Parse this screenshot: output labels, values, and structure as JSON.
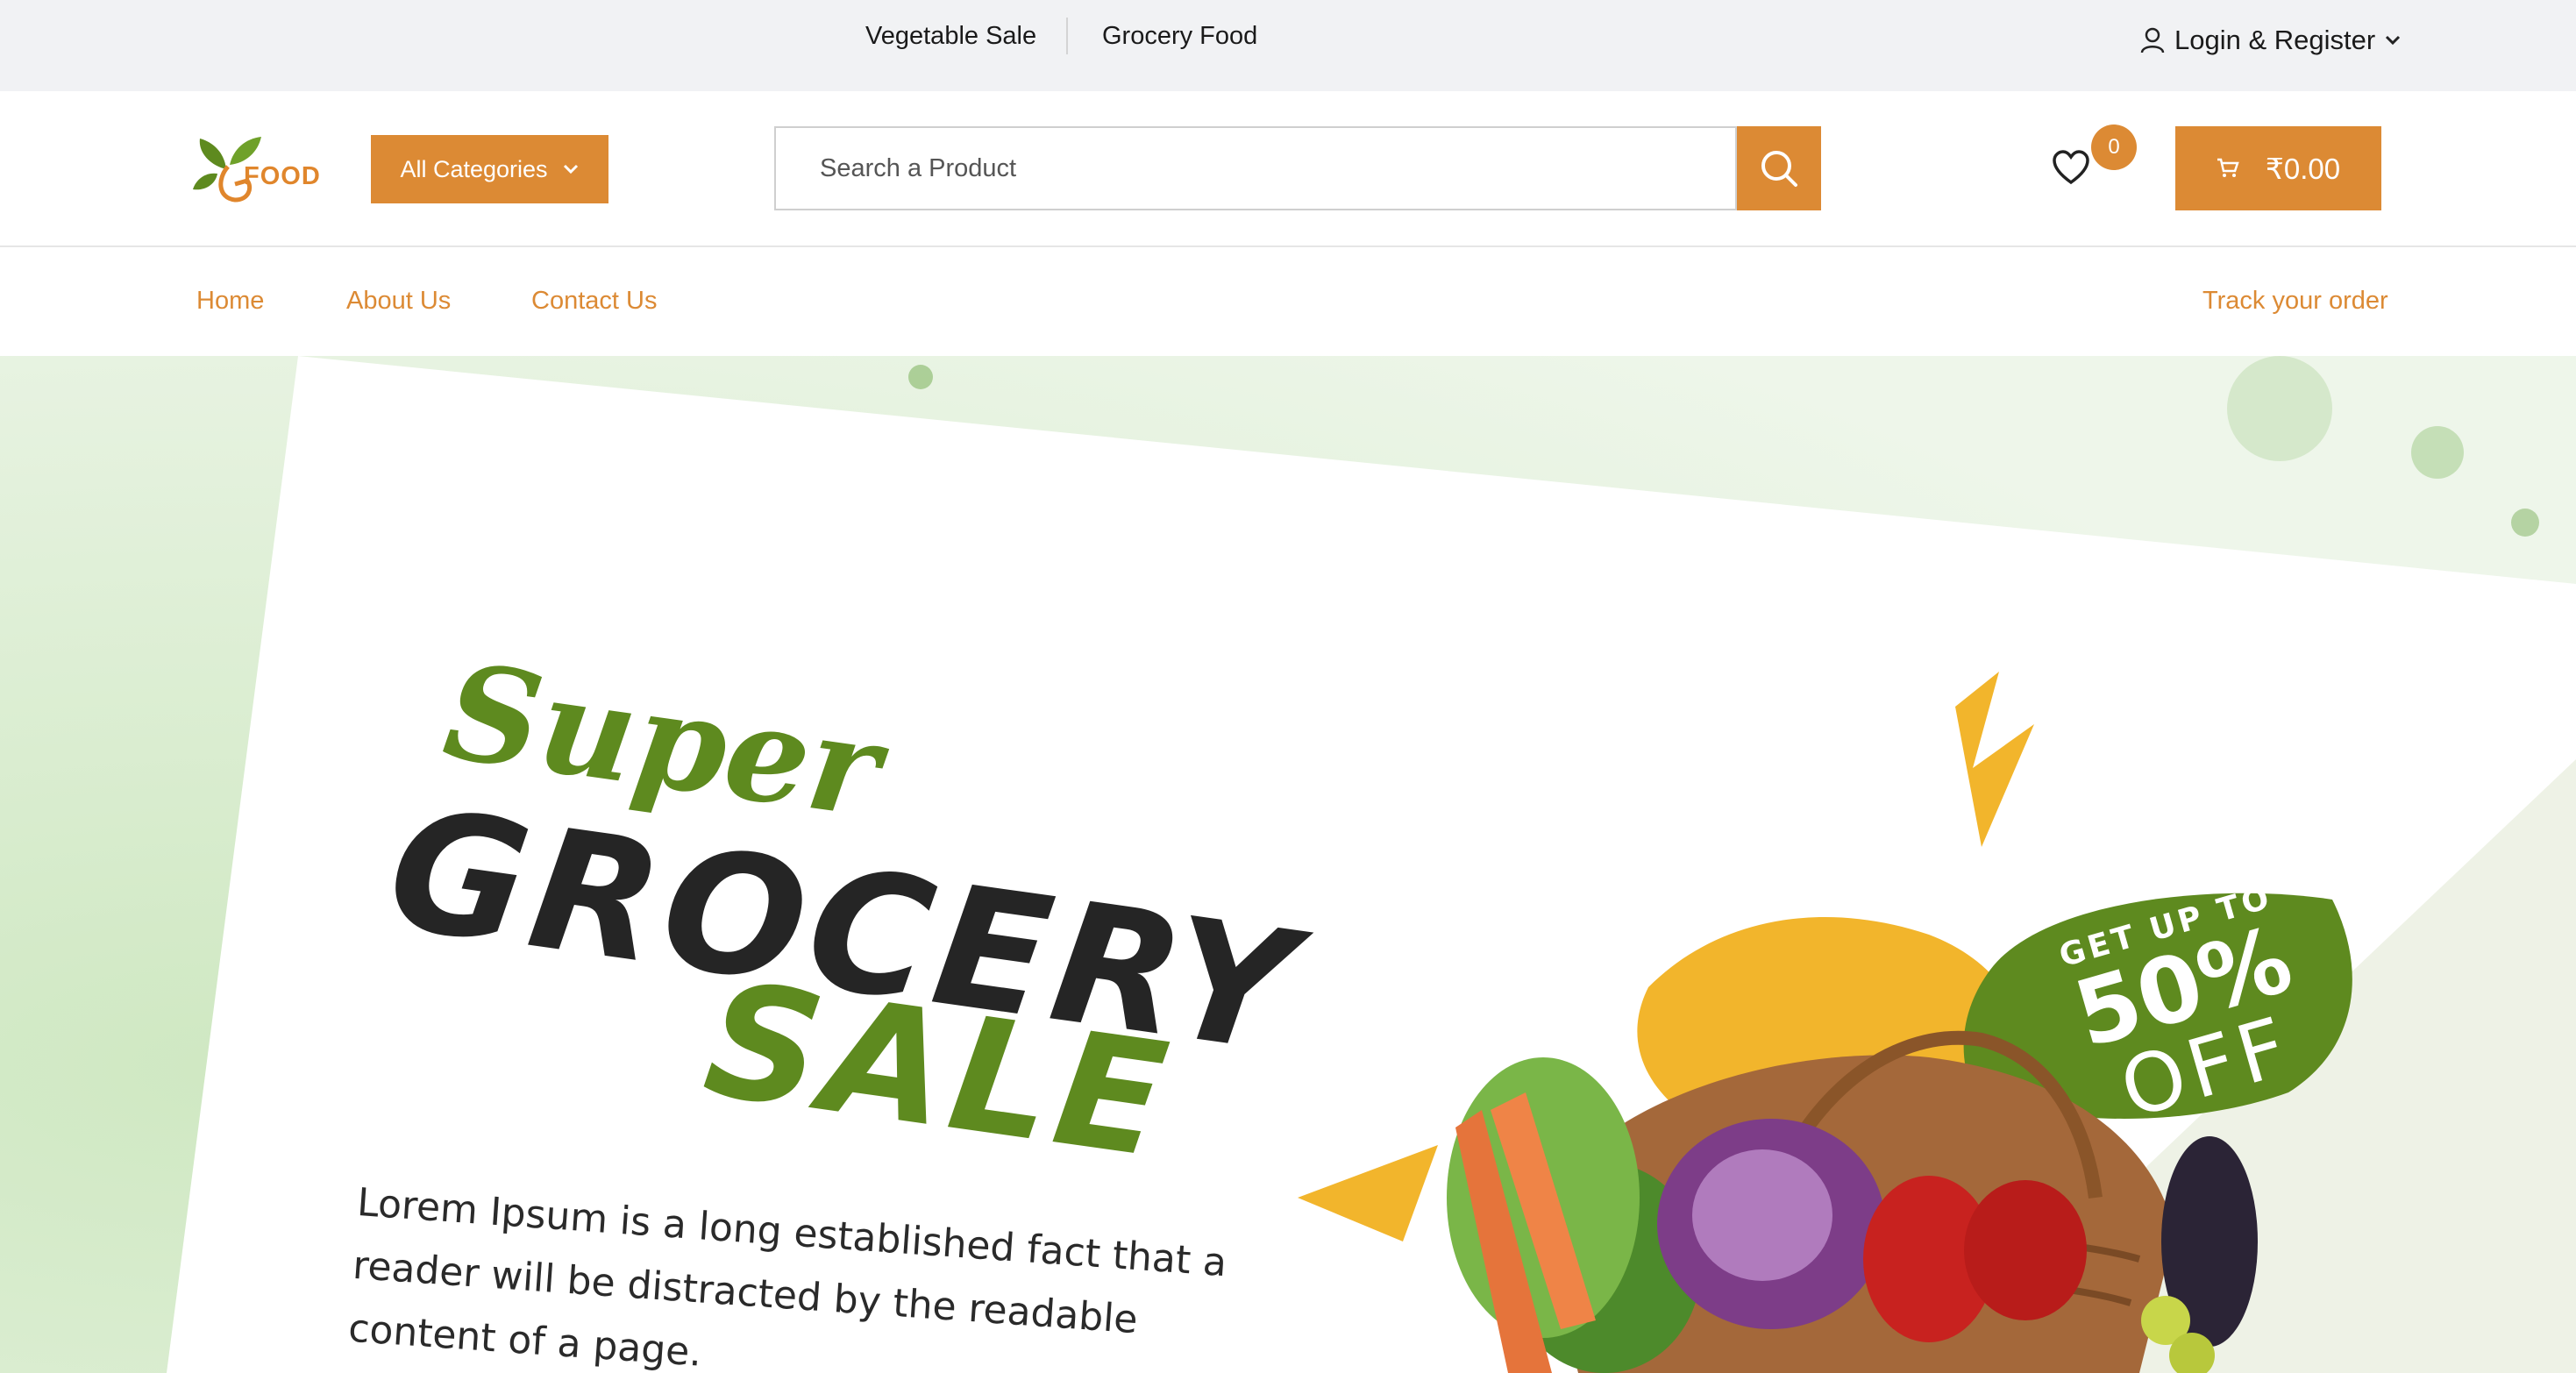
{
  "topbar": {
    "links": [
      "Vegetable Sale",
      "Grocery Food"
    ],
    "login_label": "Login & Register"
  },
  "header": {
    "logo_text": "FOOD",
    "categories_label": "All Categories",
    "search_placeholder": "Search a Product",
    "wishlist_count": "0",
    "cart_total": "₹0.00"
  },
  "nav": {
    "links": [
      "Home",
      "About Us",
      "Contact Us"
    ],
    "track_label": "Track your order"
  },
  "hero": {
    "script_word": "Super",
    "headline_1": "GROCERY",
    "headline_2": "SALE",
    "body_lines": [
      "Lorem Ipsum is a long established fact that a",
      "reader will be distracted by the readable",
      "content of a page."
    ],
    "badge_line1": "GET UP TO",
    "badge_line2": "50%",
    "badge_line3": "OFF"
  },
  "colors": {
    "accent": "#dc8a34",
    "green": "#5e8a1f",
    "topbar_bg": "#f1f2f4"
  }
}
